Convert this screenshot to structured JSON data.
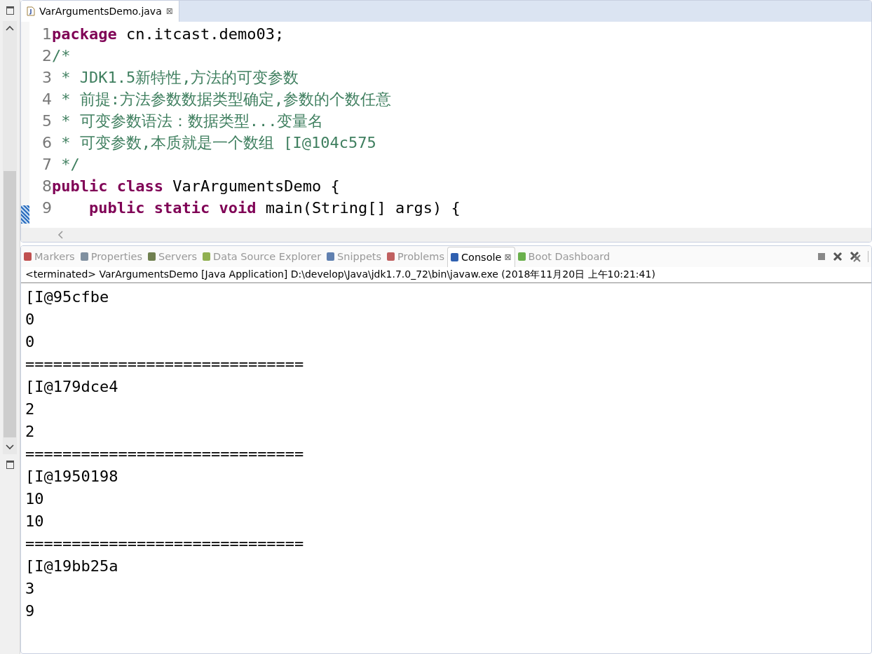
{
  "editor": {
    "tab": {
      "label": "VarArgumentsDemo.java",
      "close": "⊠",
      "selected": true
    },
    "lines": [
      {
        "number": "1",
        "tokens": [
          {
            "kind": "keyword",
            "text": "package"
          },
          {
            "kind": "plain",
            "text": " cn.itcast.demo03;"
          }
        ]
      },
      {
        "number": "2",
        "tokens": [
          {
            "kind": "comment",
            "text": "/*"
          }
        ]
      },
      {
        "number": "3",
        "tokens": [
          {
            "kind": "comment",
            "text": " * JDK1.5新特性,方法的可变参数"
          }
        ]
      },
      {
        "number": "4",
        "tokens": [
          {
            "kind": "comment",
            "text": " * 前提:方法参数数据类型确定,参数的个数任意"
          }
        ]
      },
      {
        "number": "5",
        "tokens": [
          {
            "kind": "comment",
            "text": " * 可变参数语法：数据类型...变量名"
          }
        ]
      },
      {
        "number": "6",
        "tokens": [
          {
            "kind": "comment",
            "text": " * 可变参数,本质就是一个数组 [I@104c575"
          }
        ]
      },
      {
        "number": "7",
        "tokens": [
          {
            "kind": "comment",
            "text": " */"
          }
        ]
      },
      {
        "number": "8",
        "tokens": [
          {
            "kind": "keyword",
            "text": "public"
          },
          {
            "kind": "keyword",
            "text": " class"
          },
          {
            "kind": "plain",
            "text": " VarArgumentsDemo {"
          }
        ]
      },
      {
        "number": "9",
        "tokens": [
          {
            "kind": "keyword",
            "text": "    public"
          },
          {
            "kind": "keyword",
            "text": " static"
          },
          {
            "kind": "keyword",
            "text": " void"
          },
          {
            "kind": "plain",
            "text": " main(String[] args) {"
          }
        ]
      }
    ]
  },
  "console": {
    "tabs": [
      {
        "label": "Markers",
        "selected": false
      },
      {
        "label": "Properties",
        "selected": false
      },
      {
        "label": "Servers",
        "selected": false
      },
      {
        "label": "Data Source Explorer",
        "selected": false
      },
      {
        "label": "Snippets",
        "selected": false
      },
      {
        "label": "Problems",
        "selected": false
      },
      {
        "label": "Console",
        "selected": true,
        "close": "⊠"
      },
      {
        "label": "Boot Dashboard",
        "selected": false
      }
    ],
    "header": "<terminated> VarArgumentsDemo [Java Application] D:\\develop\\Java\\jdk1.7.0_72\\bin\\javaw.exe (2018年11月20日 上午10:21:41)",
    "output": [
      "[I@95cfbe",
      "0",
      "0",
      "==============================",
      "[I@179dce4",
      "2",
      "2",
      "==============================",
      "[I@1950198",
      "10",
      "10",
      "==============================",
      "[I@19bb25a",
      "3",
      "9"
    ]
  }
}
